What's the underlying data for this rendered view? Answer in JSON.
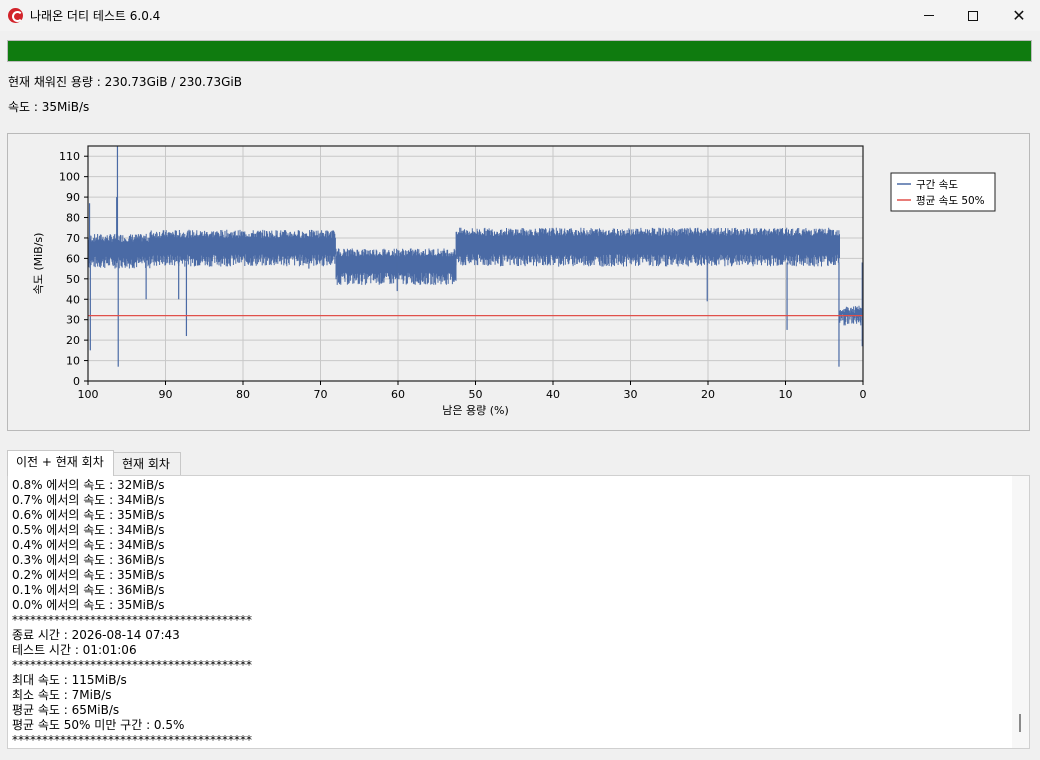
{
  "window": {
    "title": "나래온 더티 테스트 6.0.4",
    "icons": {
      "min": "minimize-icon",
      "max": "maximize-icon",
      "close": "close-icon"
    }
  },
  "progress": {
    "fraction": 1.0,
    "color": "#0f7b0f"
  },
  "status": {
    "filled": "현재 채워진 용량 : 230.73GiB / 230.73GiB",
    "speed": "속도 : 35MiB/s"
  },
  "chart_data": {
    "type": "line",
    "xlabel": "남은 용량 (%)",
    "ylabel": "속도 (MiB/s)",
    "xlim": [
      100,
      0
    ],
    "ylim": [
      0,
      115
    ],
    "x_ticks": [
      "100",
      "90",
      "80",
      "70",
      "60",
      "50",
      "40",
      "30",
      "20",
      "10",
      "0"
    ],
    "y_ticks": [
      "0",
      "10",
      "20",
      "30",
      "40",
      "50",
      "60",
      "70",
      "80",
      "90",
      "100",
      "110"
    ],
    "grid": true,
    "legend_position": "right",
    "series": [
      {
        "name": "구간 속도",
        "color": "#4a6aa5",
        "segments": [
          {
            "from": 100,
            "to": 92,
            "low": 58,
            "high": 71
          },
          {
            "from": 92,
            "to": 68,
            "low": 59,
            "high": 73
          },
          {
            "from": 68,
            "to": 52.5,
            "low": 50,
            "high": 64
          },
          {
            "from": 52.5,
            "to": 3,
            "low": 59,
            "high": 74
          },
          {
            "from": 3,
            "to": 0,
            "low": 30,
            "high": 36
          }
        ],
        "spikes": [
          {
            "x": 99.7,
            "y": 15
          },
          {
            "x": 99.8,
            "y": 87
          },
          {
            "x": 96.2,
            "y": 115
          },
          {
            "x": 96.1,
            "y": 7
          },
          {
            "x": 96.3,
            "y": 90
          },
          {
            "x": 92.5,
            "y": 40
          },
          {
            "x": 88.3,
            "y": 40
          },
          {
            "x": 87.3,
            "y": 22
          },
          {
            "x": 71.5,
            "y": 55
          },
          {
            "x": 60.1,
            "y": 44
          },
          {
            "x": 20.1,
            "y": 39
          },
          {
            "x": 9.8,
            "y": 25
          },
          {
            "x": 3.1,
            "y": 7
          },
          {
            "x": 0.1,
            "y": 17
          }
        ]
      },
      {
        "name": "평균 속도 50%",
        "color": "#e0504a",
        "y": 32
      }
    ]
  },
  "tabs": [
    {
      "label": "이전 + 현재 회차",
      "active": true
    },
    {
      "label": "현재 회차",
      "active": false
    }
  ],
  "log": {
    "lines": [
      "0.8% 에서의 속도 : 32MiB/s",
      "0.7% 에서의 속도 : 34MiB/s",
      "0.6% 에서의 속도 : 35MiB/s",
      "0.5% 에서의 속도 : 34MiB/s",
      "0.4% 에서의 속도 : 34MiB/s",
      "0.3% 에서의 속도 : 36MiB/s",
      "0.2% 에서의 속도 : 35MiB/s",
      "0.1% 에서의 속도 : 36MiB/s",
      "0.0% 에서의 속도 : 35MiB/s",
      "****************************************",
      "종료 시간 : 2026-08-14 07:43",
      "테스트 시간 : 01:01:06",
      "****************************************",
      "최대 속도 : 115MiB/s",
      "최소 속도 : 7MiB/s",
      "평균 속도 : 65MiB/s",
      "평균 속도 50% 미만 구간 : 0.5%",
      "****************************************"
    ]
  }
}
